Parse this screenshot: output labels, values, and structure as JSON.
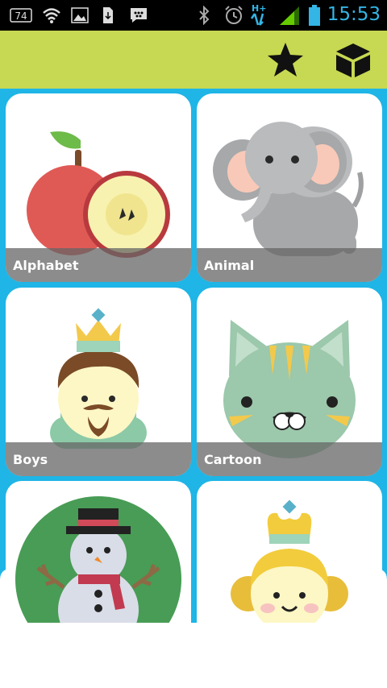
{
  "status_bar": {
    "time": "15:53",
    "notification_count": "74",
    "network_type": "H+",
    "icons": [
      "notification-badge-icon",
      "wifi-icon",
      "gallery-icon",
      "file-download-icon",
      "chat-icon",
      "bluetooth-icon",
      "alarm-icon",
      "signal-icon",
      "battery-icon"
    ],
    "clock_color": "#33b5e5"
  },
  "app_bar": {
    "background": "#c7d852",
    "actions": [
      {
        "name": "favorites",
        "icon": "star-icon"
      },
      {
        "name": "store",
        "icon": "box-icon"
      }
    ]
  },
  "grid": {
    "background": "#1fb5e6",
    "categories": [
      {
        "label": "Alphabet",
        "icon": "apple-icon"
      },
      {
        "label": "Animal",
        "icon": "elephant-icon"
      },
      {
        "label": "Boys",
        "icon": "king-icon"
      },
      {
        "label": "Cartoon",
        "icon": "cat-icon"
      },
      {
        "label": "",
        "icon": "snowman-icon"
      },
      {
        "label": "",
        "icon": "princess-icon"
      }
    ]
  }
}
